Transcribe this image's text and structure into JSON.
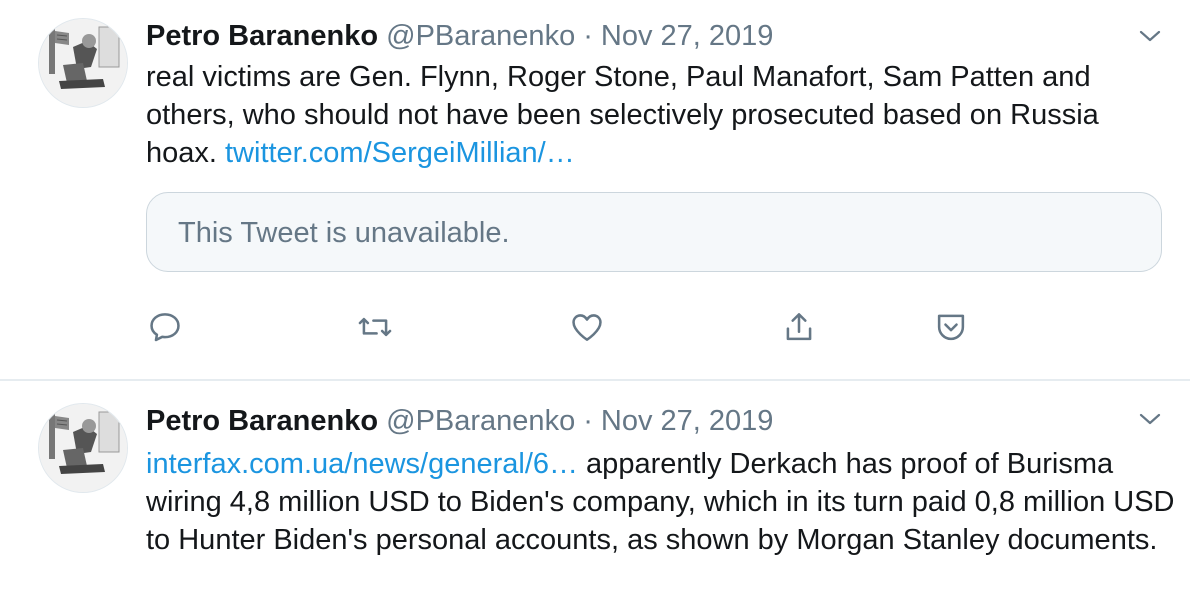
{
  "tweets": [
    {
      "name": "Petro Baranenko",
      "handle": "@PBaranenko",
      "separator": "·",
      "date": "Nov 27, 2019",
      "text_before_link": "real victims are Gen. Flynn, Roger Stone, Paul Manafort, Sam Patten and others, who should not have been selectively prosecuted based on Russia hoax. ",
      "link": "twitter.com/SergeiMillian/…",
      "quoted": "This Tweet is unavailable.",
      "actions": [
        "reply-icon",
        "retweet-icon",
        "like-icon",
        "share-icon",
        "analytics-icon"
      ]
    },
    {
      "name": "Petro Baranenko",
      "handle": "@PBaranenko",
      "separator": "·",
      "date": "Nov 27, 2019",
      "link": "interfax.com.ua/news/general/6…",
      "text_after_link": " apparently Derkach has proof of Burisma wiring 4,8 million USD to Biden's company, which in its turn paid 0,8 million USD to Hunter Biden's personal accounts, as shown by Morgan Stanley documents."
    }
  ],
  "colors": {
    "text": "#14171a",
    "muted": "#657786",
    "link": "#1b95e0",
    "border": "#e6ecf0",
    "quote_bg": "#f5f8fa"
  }
}
